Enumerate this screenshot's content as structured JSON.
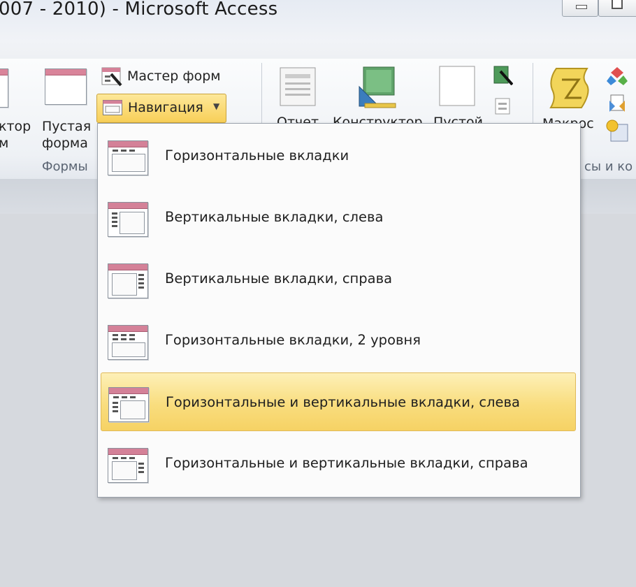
{
  "window": {
    "title": "007 - 2010)  -  Microsoft Access"
  },
  "ribbon": {
    "left_labels": [
      "ктор",
      "м"
    ],
    "blank_form_label": [
      "Пустая",
      "форма"
    ],
    "group_forms": "Формы",
    "form_wizard": "Мастер форм",
    "navigation_button": "Навигация",
    "partial_labels": [
      "Отчет",
      "Конструктор",
      "Пустой"
    ],
    "macro_label": "Макрос",
    "group_macros": "сы и ко"
  },
  "menu": {
    "items": [
      {
        "label": "Горизонтальные вкладки",
        "active": false
      },
      {
        "label": "Вертикальные вкладки, слева",
        "active": false
      },
      {
        "label": "Вертикальные вкладки, справа",
        "active": false
      },
      {
        "label": "Горизонтальные вкладки, 2 уровня",
        "active": false
      },
      {
        "label": "Горизонтальные и вертикальные вкладки, слева",
        "active": true
      },
      {
        "label": "Горизонтальные и вертикальные вкладки, справа",
        "active": false
      }
    ]
  },
  "colors": {
    "highlight": "#f9dd7e",
    "form_header": "#d9849a"
  }
}
